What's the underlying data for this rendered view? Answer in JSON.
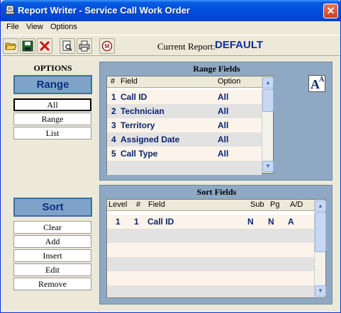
{
  "window": {
    "title": "Report Writer - Service Call Work Order",
    "close": "✕"
  },
  "menu": {
    "items": [
      "File",
      "View",
      "Options"
    ]
  },
  "toolbar": {
    "icons": [
      "open-folder-icon",
      "save-disk-icon",
      "delete-x-icon",
      "print-preview-icon",
      "printer-icon",
      "report-badge-icon"
    ],
    "current_label": "Current Report:",
    "current_value": "DEFAULT"
  },
  "options": {
    "header": "OPTIONS",
    "range_button": "Range",
    "range_items": [
      "All",
      "Range",
      "List"
    ],
    "sort_button": "Sort",
    "sort_items": [
      "Clear",
      "Add",
      "Insert",
      "Edit",
      "Remove"
    ]
  },
  "range_fields": {
    "title": "Range  Fields",
    "columns": {
      "num": "#",
      "field": "Field",
      "option": "Option"
    },
    "rows": [
      {
        "num": "1",
        "field": "Call ID",
        "option": "All"
      },
      {
        "num": "2",
        "field": "Technician",
        "option": "All"
      },
      {
        "num": "3",
        "field": "Territory",
        "option": "All"
      },
      {
        "num": "4",
        "field": "Assigned Date",
        "option": "All"
      },
      {
        "num": "5",
        "field": "Call Type",
        "option": "All"
      }
    ]
  },
  "sort_fields": {
    "title": "Sort Fields",
    "columns": {
      "level": "Level",
      "num": "#",
      "field": "Field",
      "sub": "Sub",
      "pg": "Pg",
      "ad": "A/D"
    },
    "rows": [
      {
        "level": "1",
        "num": "1",
        "field": "Call ID",
        "sub": "N",
        "pg": "N",
        "ad": "A"
      }
    ]
  },
  "font_button": {
    "big": "A",
    "small": "A"
  },
  "colors": {
    "row_even": "#fcf3ea",
    "row_odd": "#e2e2e2",
    "accent": "#1030a0"
  }
}
